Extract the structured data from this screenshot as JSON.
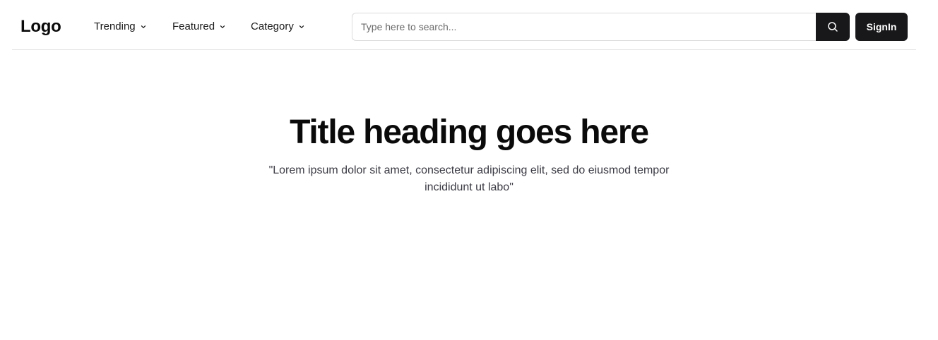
{
  "header": {
    "logo": "Logo",
    "nav": [
      {
        "label": "Trending",
        "icon": "chevron-down-icon"
      },
      {
        "label": "Featured",
        "icon": "chevron-down-icon"
      },
      {
        "label": "Category",
        "icon": "chevron-down-icon"
      }
    ],
    "search": {
      "placeholder": "Type here to search...",
      "value": "",
      "button_icon": "search-icon"
    },
    "signin_label": "SignIn"
  },
  "hero": {
    "title": "Title heading goes here",
    "subtitle": "\"Lorem ipsum dolor sit amet, consectetur adipiscing elit, sed do eiusmod tempor incididunt ut labo\""
  },
  "colors": {
    "accent": "#18181b",
    "divider": "#e2e2e2",
    "background": "#ffffff"
  }
}
